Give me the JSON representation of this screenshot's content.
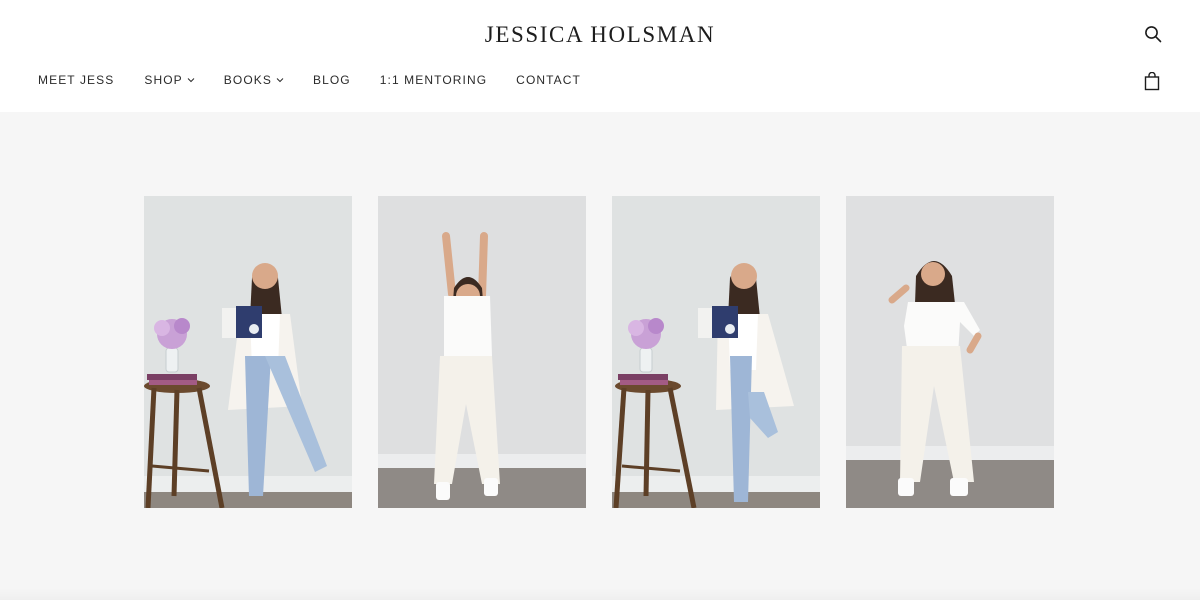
{
  "header": {
    "brand": "JESSICA HOLSMAN",
    "search_icon": "search-icon",
    "cart_icon": "shopping-bag-icon"
  },
  "nav": {
    "items": [
      {
        "label": "MEET JESS",
        "has_dropdown": false
      },
      {
        "label": "SHOP",
        "has_dropdown": true
      },
      {
        "label": "BOOKS",
        "has_dropdown": true
      },
      {
        "label": "BLOG",
        "has_dropdown": false
      },
      {
        "label": "1:1 MENTORING",
        "has_dropdown": false
      },
      {
        "label": "CONTACT",
        "has_dropdown": false
      }
    ]
  },
  "gallery": {
    "photos": [
      {
        "pose": "book-stool",
        "outfit": "blazer-jeans"
      },
      {
        "pose": "arms-up",
        "outfit": "white"
      },
      {
        "pose": "book-stool-leg-up",
        "outfit": "blazer-jeans"
      },
      {
        "pose": "hand-in-hair",
        "outfit": "white"
      }
    ]
  },
  "colors": {
    "page_bg": "#f6f6f6",
    "header_bg": "#ffffff",
    "wall": "#dfe2e2",
    "floor": "#8e8780",
    "text": "#2a2a2a"
  }
}
